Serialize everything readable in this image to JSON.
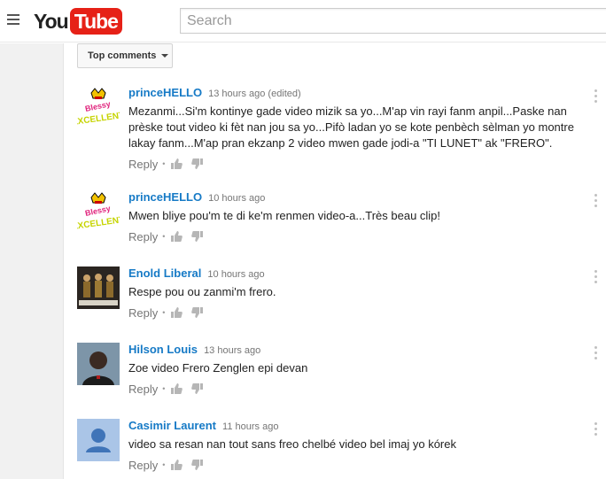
{
  "header": {
    "logo_you": "You",
    "logo_tube": "Tube",
    "search_placeholder": "Search"
  },
  "sort": {
    "label": "Top comments"
  },
  "actions": {
    "reply_label": "Reply",
    "dot": "•"
  },
  "comments": [
    {
      "author": "princeHELLO",
      "time": "13 hours ago (edited)",
      "text": "Mezanmi...Si'm kontinye gade video mizik sa yo...M'ap vin rayi fanm anpil...Paske nan prèske tout video ki fèt nan jou sa yo...Pifò ladan yo se kote penbèch sèlman yo montre lakay fanm...M'ap pran ekzanp 2 video mwen gade jodi-a \"TI LUNET\" ak \"FRERO\".",
      "avatar_icon": "crown-icon"
    },
    {
      "author": "princeHELLO",
      "time": "10 hours ago",
      "text": "Mwen bliye pou'm te di ke'm renmen video-a...Très beau clip!",
      "avatar_icon": "crown-icon"
    },
    {
      "author": "Enold Liberal",
      "time": "10 hours ago",
      "text": "Respe pou ou zanmi'm frero.",
      "avatar_icon": "group-photo-icon"
    },
    {
      "author": "Hilson Louis",
      "time": "13 hours ago",
      "text": "Zoe video Frero Zenglen epi devan",
      "avatar_icon": "person-photo-icon"
    },
    {
      "author": "Casimir Laurent",
      "time": "11 hours ago",
      "text": "video sa resan nan tout sans freo chelbé video bel imaj yo kórek",
      "avatar_icon": "default-user-icon"
    }
  ],
  "colors": {
    "link": "#167ac6",
    "logo_red": "#e62117",
    "muted": "#767676"
  }
}
